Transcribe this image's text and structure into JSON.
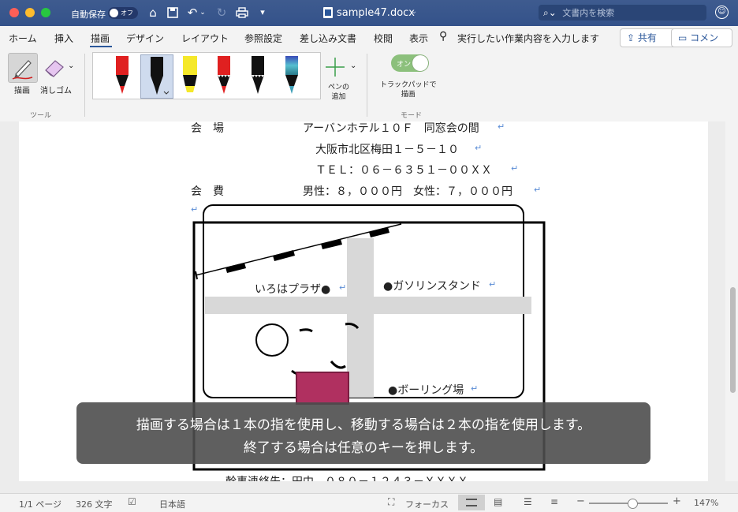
{
  "titlebar": {
    "autosave_label": "自動保存",
    "autosave_toggle": "オフ",
    "document_title": "sample47.docx",
    "search_placeholder": "文書内を検索"
  },
  "tabs": {
    "items": [
      "ホーム",
      "挿入",
      "描画",
      "デザイン",
      "レイアウト",
      "参照設定",
      "差し込み文書",
      "校閲",
      "表示"
    ],
    "active": "描画",
    "tell_me": "実行したい作業内容を入力します",
    "share_label": "共有",
    "comment_label": "コメント"
  },
  "ribbon": {
    "tools": {
      "draw_label": "描画",
      "eraser_label": "消しゴム",
      "group_label": "ツール"
    },
    "pens": [
      {
        "name": "red-pen",
        "color": "#e02020"
      },
      {
        "name": "black-pen",
        "color": "#111111",
        "selected": true
      },
      {
        "name": "yellow-highlighter",
        "color": "#f5e82a"
      },
      {
        "name": "red-pencil",
        "color": "#e02020"
      },
      {
        "name": "black-pencil",
        "color": "#111111"
      },
      {
        "name": "galaxy-pen",
        "color": "#3fa0b8"
      }
    ],
    "add_pen_label": "ペンの\n追加",
    "mode": {
      "toggle_state": "オン",
      "trackpad_label": "トラックパッドで\n描画",
      "group_label": "モード"
    }
  },
  "document": {
    "lines": [
      {
        "left": "会　場",
        "right": "アーバンホテル１０Ｆ　同窓会の間"
      },
      {
        "left": "",
        "right": "大阪市北区梅田１－５－１０"
      },
      {
        "left": "",
        "right": "ＴＥＬ：０６－６３５１－００ＸＸ"
      },
      {
        "left": "会　費",
        "right": "男性：８，０００円　女性：７，０００円"
      }
    ],
    "map_labels": {
      "iroha": "いろはプラザ●",
      "gas": "●ガソリンスタンド",
      "bowling": "●ボーリング場"
    },
    "bottom_line": "幹事連絡先：田中　０８０－１２４３－ＸＸＸＸ",
    "paragraph_mark": "↵"
  },
  "overlay": {
    "line1": "描画する場合は１本の指を使用し、移動する場合は２本の指を使用します。",
    "line2": "終了する場合は任意のキーを押します。"
  },
  "statusbar": {
    "page": "1/1 ページ",
    "words": "326 文字",
    "language": "日本語",
    "focus": "フォーカス",
    "zoom": "147%"
  },
  "colors": {
    "titlebar": "#34528a",
    "accent": "#2b579a",
    "highlight": "#b03060"
  }
}
